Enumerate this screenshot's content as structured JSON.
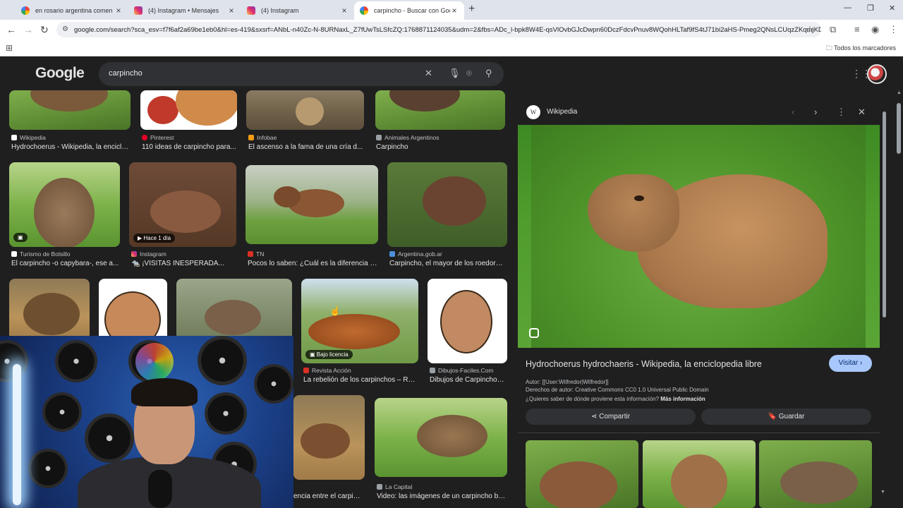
{
  "tabs": [
    {
      "title": "en rosario argentina comen ga",
      "favicon": "google-icon"
    },
    {
      "title": "(4) Instagram • Mensajes",
      "favicon": "instagram-icon"
    },
    {
      "title": "(4) Instagram",
      "favicon": "instagram-icon"
    },
    {
      "title": "carpincho - Buscar con Google",
      "favicon": "google-icon",
      "active": true
    }
  ],
  "address": {
    "url": "google.com/search?sca_esv=f7f6af2a69be1eb0&hl=es-419&sxsrf=ANbL-n40Zc-N-8URNaxL_Z7fUwTsLSfcZQ:1768871124035&udm=2&fbs=ADc_l-bpk8W4E-qsVlOvbGJcDwpn60DczFdcvPnuv8WQohHLTaf9fS4tJ71bi2aHS-Pmeg2QNsLCUqzZKqmjKD..."
  },
  "bookmarks": {
    "all_label": "Todos los marcadores"
  },
  "google": {
    "logo": "Google",
    "query": "carpincho"
  },
  "results": [
    {
      "source": "Wikipedia",
      "caption": "Hydrochoerus - Wikipedia, la enciclo..."
    },
    {
      "source": "Pinterest",
      "caption": "110 ideas de carpincho para..."
    },
    {
      "source": "Infobae",
      "caption": "El ascenso a la fama de una cría d..."
    },
    {
      "source": "Animales Argentinos",
      "caption": "Carpincho"
    },
    {
      "source": "Turismo de Bolsillo",
      "caption": "El carpincho -o capybara-, ese a..."
    },
    {
      "source": "Instagram",
      "caption": "🐀 ¡VISITAS INESPERADA...",
      "badge": "Hace 1 día"
    },
    {
      "source": "TN",
      "caption": "Pocos lo saben: ¿Cuál es la diferencia e..."
    },
    {
      "source": "Argentina.gob.ar",
      "caption": "Carpincho, el mayor de los roedores..."
    },
    {
      "source": "Revista Acción",
      "caption": "La rebelión de los carpinchos – Re...",
      "badge": "Bajo licencia"
    },
    {
      "source": "Dibujos-Faciles.Com",
      "caption": "Dibujos de Carpincho -..."
    },
    {
      "source": "",
      "caption": "encia entre el carpinc..."
    },
    {
      "source": "La Capital",
      "caption": "Video: las imágenes de un carpincho be..."
    }
  ],
  "panel": {
    "site": "Wikipedia",
    "title": "Hydrochoerus hydrochaeris - Wikipedia, la enciclopedia libre",
    "visit": "Visitar",
    "author": "Autor: [[User:Wilfredor|Wilfredor]]",
    "rights": "Derechos de autor: Creative Commons CC0 1.0 Universal Public Domain",
    "info_q": "¿Quieres saber de dónde proviene esta información?",
    "info_link": "Más información",
    "share": "Compartir",
    "save": "Guardar"
  }
}
